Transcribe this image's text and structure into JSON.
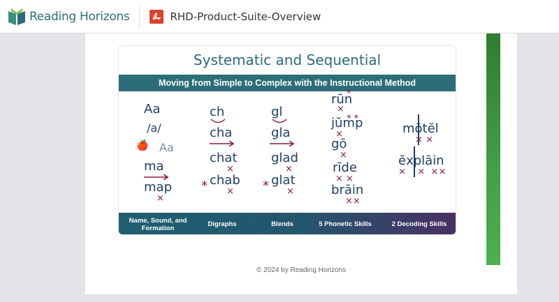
{
  "header": {
    "brand": "Reading Horizons",
    "document_title": "RHD-Product-Suite-Overview"
  },
  "slide": {
    "title": "Systematic and Sequential",
    "subtitle": "Moving from Simple to Complex with the Instructional Method",
    "columns": [
      {
        "words": [
          "Aa",
          "/a/",
          "Aa",
          "ma",
          "map"
        ]
      },
      {
        "words": [
          "ch",
          "cha",
          "chat",
          "chab"
        ]
      },
      {
        "words": [
          "gl",
          "gla",
          "glad",
          "glat"
        ]
      },
      {
        "words": [
          "rŭn",
          "jŭmp",
          "gō",
          "rīde",
          "brāin"
        ]
      },
      {
        "words": [
          "mōtĕl",
          "ĕxplāin"
        ]
      }
    ],
    "categories": [
      "Name, Sound, and Formation",
      "Digraphs",
      "Blends",
      "5 Phonetic Skills",
      "2 Decoding Skills"
    ]
  },
  "footer": {
    "copyright": "© 2024 by Reading Horizons"
  },
  "colors": {
    "accent": "#2b6d78",
    "brand_text": "#2a6f7a",
    "word": "#1f3f66",
    "mark": "#8b1a3c",
    "side_bar": "#43a047",
    "pdf": "#d9432f"
  }
}
